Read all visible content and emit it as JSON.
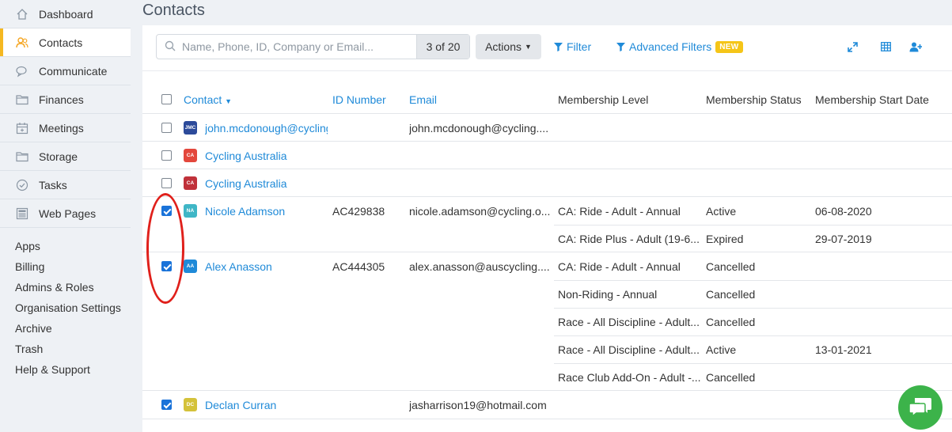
{
  "page_title": "Contacts",
  "sidebar": {
    "items": [
      {
        "label": "Dashboard",
        "icon": "home-icon",
        "active": false
      },
      {
        "label": "Contacts",
        "icon": "contacts-icon",
        "active": true
      },
      {
        "label": "Communicate",
        "icon": "chat-bubbles-icon",
        "active": false
      },
      {
        "label": "Finances",
        "icon": "folder-icon",
        "active": false
      },
      {
        "label": "Meetings",
        "icon": "calendar-icon",
        "active": false
      },
      {
        "label": "Storage",
        "icon": "folder-icon",
        "active": false
      },
      {
        "label": "Tasks",
        "icon": "check-circle-icon",
        "active": false
      },
      {
        "label": "Web Pages",
        "icon": "web-page-icon",
        "active": false
      }
    ],
    "links": [
      "Apps",
      "Billing",
      "Admins & Roles",
      "Organisation Settings",
      "Archive",
      "Trash",
      "Help & Support"
    ]
  },
  "toolbar": {
    "search_placeholder": "Name, Phone, ID, Company or Email...",
    "result_count": "3 of 20",
    "actions_label": "Actions",
    "filter_label": "Filter",
    "advanced_filters_label": "Advanced Filters",
    "new_badge": "NEW"
  },
  "table": {
    "headers": {
      "contact": "Contact",
      "id_number": "ID Number",
      "email": "Email",
      "membership_level": "Membership Level",
      "membership_status": "Membership Status",
      "membership_start": "Membership Start Date"
    },
    "rows": [
      {
        "checked": false,
        "initials": "JMC",
        "avatar_color": "#2c4a9a",
        "name": "john.mcdonough@cycling",
        "id": "",
        "email": "john.mcdonough@cycling....",
        "memberships": []
      },
      {
        "checked": false,
        "initials": "CA",
        "avatar_color": "#e3473c",
        "name": "Cycling Australia",
        "id": "",
        "email": "",
        "memberships": []
      },
      {
        "checked": false,
        "initials": "CA",
        "avatar_color": "#c0313a",
        "name": "Cycling Australia",
        "id": "",
        "email": "",
        "memberships": []
      },
      {
        "checked": true,
        "initials": "NA",
        "avatar_color": "#3fb6c6",
        "name": "Nicole Adamson",
        "id": "AC429838",
        "email": "nicole.adamson@cycling.o...",
        "memberships": [
          {
            "level": "CA: Ride - Adult - Annual",
            "status": "Active",
            "start": "06-08-2020"
          },
          {
            "level": "CA: Ride Plus - Adult (19-6...",
            "status": "Expired",
            "start": "29-07-2019"
          }
        ]
      },
      {
        "checked": true,
        "initials": "AA",
        "avatar_color": "#1f8ad8",
        "name": "Alex Anasson",
        "id": "AC444305",
        "email": "alex.anasson@auscycling....",
        "memberships": [
          {
            "level": "CA: Ride - Adult - Annual",
            "status": "Cancelled",
            "start": ""
          },
          {
            "level": "Non-Riding - Annual",
            "status": "Cancelled",
            "start": ""
          },
          {
            "level": "Race - All Discipline - Adult...",
            "status": "Cancelled",
            "start": ""
          },
          {
            "level": "Race - All Discipline - Adult...",
            "status": "Active",
            "start": "13-01-2021"
          },
          {
            "level": "Race Club Add-On - Adult -...",
            "status": "Cancelled",
            "start": ""
          }
        ]
      },
      {
        "checked": true,
        "initials": "DC",
        "avatar_color": "#d4c23a",
        "name": "Declan Curran",
        "id": "",
        "email": "jasharrison19@hotmail.com",
        "memberships": []
      }
    ]
  }
}
